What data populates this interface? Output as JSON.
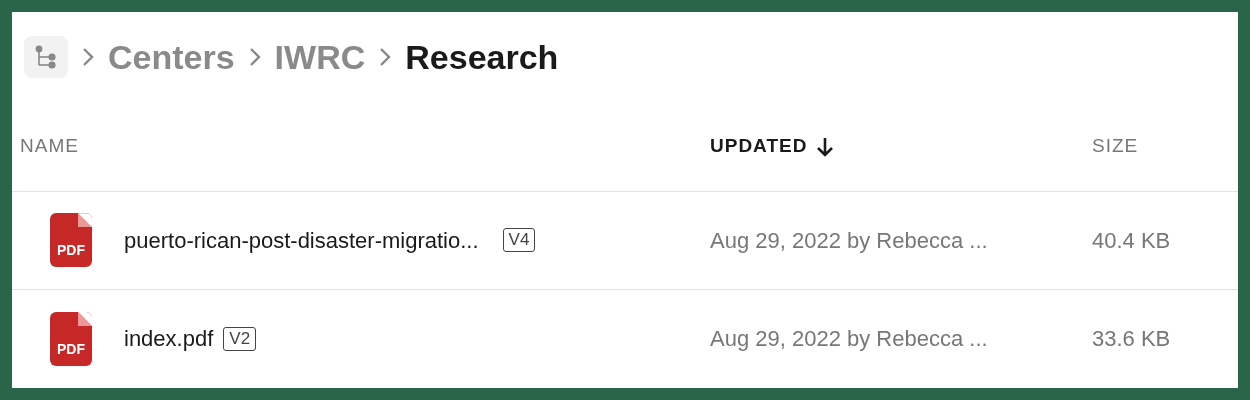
{
  "breadcrumb": [
    {
      "label": "Centers",
      "current": false
    },
    {
      "label": "IWRC",
      "current": false
    },
    {
      "label": "Research",
      "current": true
    }
  ],
  "table": {
    "columns": [
      {
        "label": "NAME",
        "sorted": false
      },
      {
        "label": "UPDATED",
        "sorted": true
      },
      {
        "label": "SIZE",
        "sorted": false
      }
    ],
    "rows": [
      {
        "icon_label": "PDF",
        "name": "puerto-rican-post-disaster-migratio...",
        "version": "V4",
        "updated": "Aug 29, 2022 by Rebecca ...",
        "size": "40.4 KB"
      },
      {
        "icon_label": "PDF",
        "name": "index.pdf",
        "version": "V2",
        "updated": "Aug 29, 2022 by Rebecca ...",
        "size": "33.6 KB"
      }
    ]
  }
}
